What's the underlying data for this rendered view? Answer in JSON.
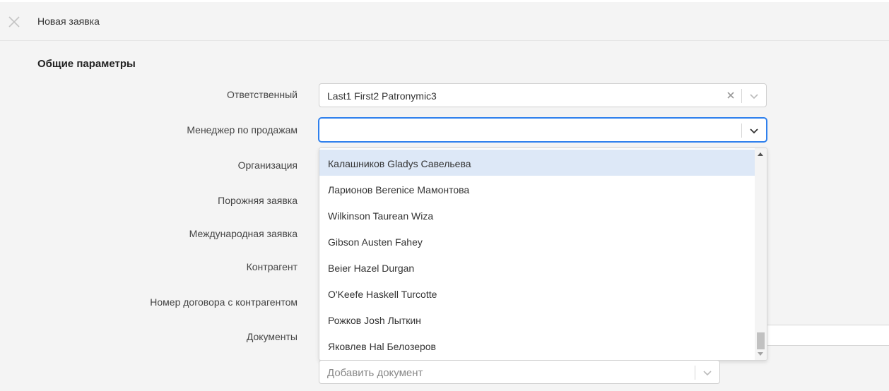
{
  "header": {
    "title": "Новая заявка",
    "close_icon": "close-icon"
  },
  "section": {
    "title": "Общие параметры"
  },
  "form": {
    "fields": [
      {
        "label": "Ответственный",
        "value": "Last1 First2 Patronymic3"
      },
      {
        "label": "Менеджер по продажам",
        "value": ""
      },
      {
        "label": "Организация"
      },
      {
        "label": "Порожняя заявка"
      },
      {
        "label": "Международная заявка"
      },
      {
        "label": "Контрагент"
      },
      {
        "label": "Номер договора с контрагентом"
      },
      {
        "label": "Документы"
      }
    ]
  },
  "dropdown": {
    "options": [
      "Калашников Gladys Савельева",
      "Ларионов Berenice Мамонтова",
      "Wilkinson Taurean Wiza",
      "Gibson Austen Fahey",
      "Beier Hazel Durgan",
      "O'Keefe Haskell Turcotte",
      "Рожков Josh Лыткин",
      "Яковлев Hal Белозеров"
    ],
    "highlighted_index": 0
  },
  "documents": {
    "add_placeholder": "Добавить документ"
  },
  "colors": {
    "focus_border": "#2f80ed",
    "highlight": "#dde8f7",
    "background": "#f4f4f4"
  }
}
